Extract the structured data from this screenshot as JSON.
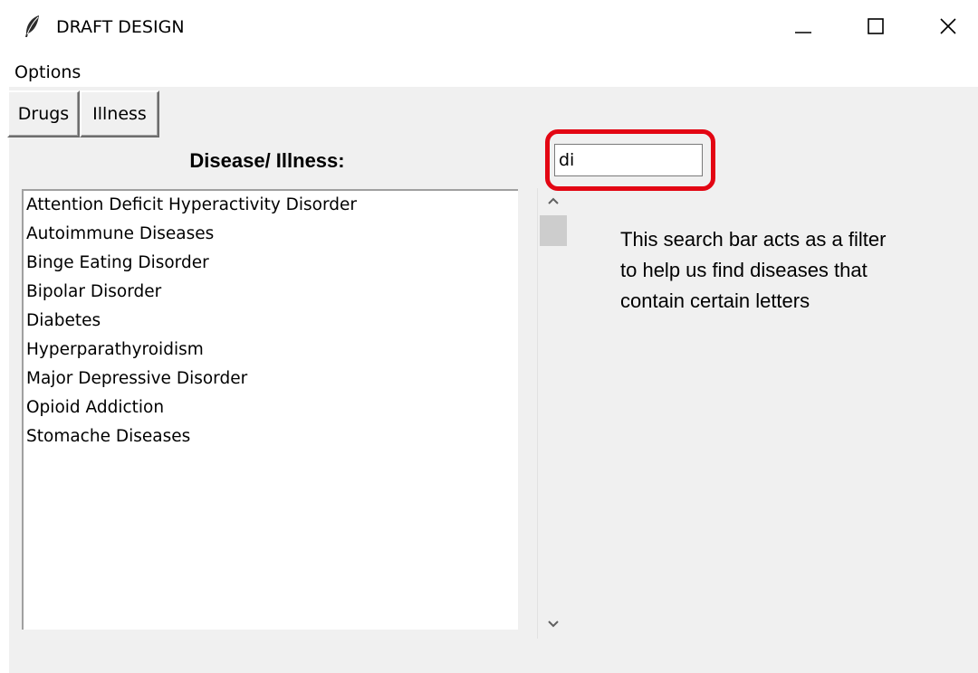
{
  "window": {
    "title": "DRAFT DESIGN",
    "icon": "feather-icon"
  },
  "menubar": {
    "items": [
      "Options"
    ]
  },
  "tabs": {
    "drugs": "Drugs",
    "illness": "Illness"
  },
  "list": {
    "heading": "Disease/ Illness:",
    "items": [
      "Attention Deficit Hyperactivity Disorder",
      "Autoimmune Diseases",
      "Binge Eating Disorder",
      "Bipolar Disorder",
      "Diabetes",
      "Hyperparathyroidism",
      "Major Depressive Disorder",
      "Opioid Addiction",
      "Stomache Diseases"
    ]
  },
  "search": {
    "value": "di",
    "highlight_color": "#e30613"
  },
  "annotation": {
    "text": "This search bar acts as a filter to help us find diseases that contain certain letters"
  },
  "colors": {
    "client_background": "#f0f0f0",
    "scroll_thumb": "#cdcdcd"
  }
}
